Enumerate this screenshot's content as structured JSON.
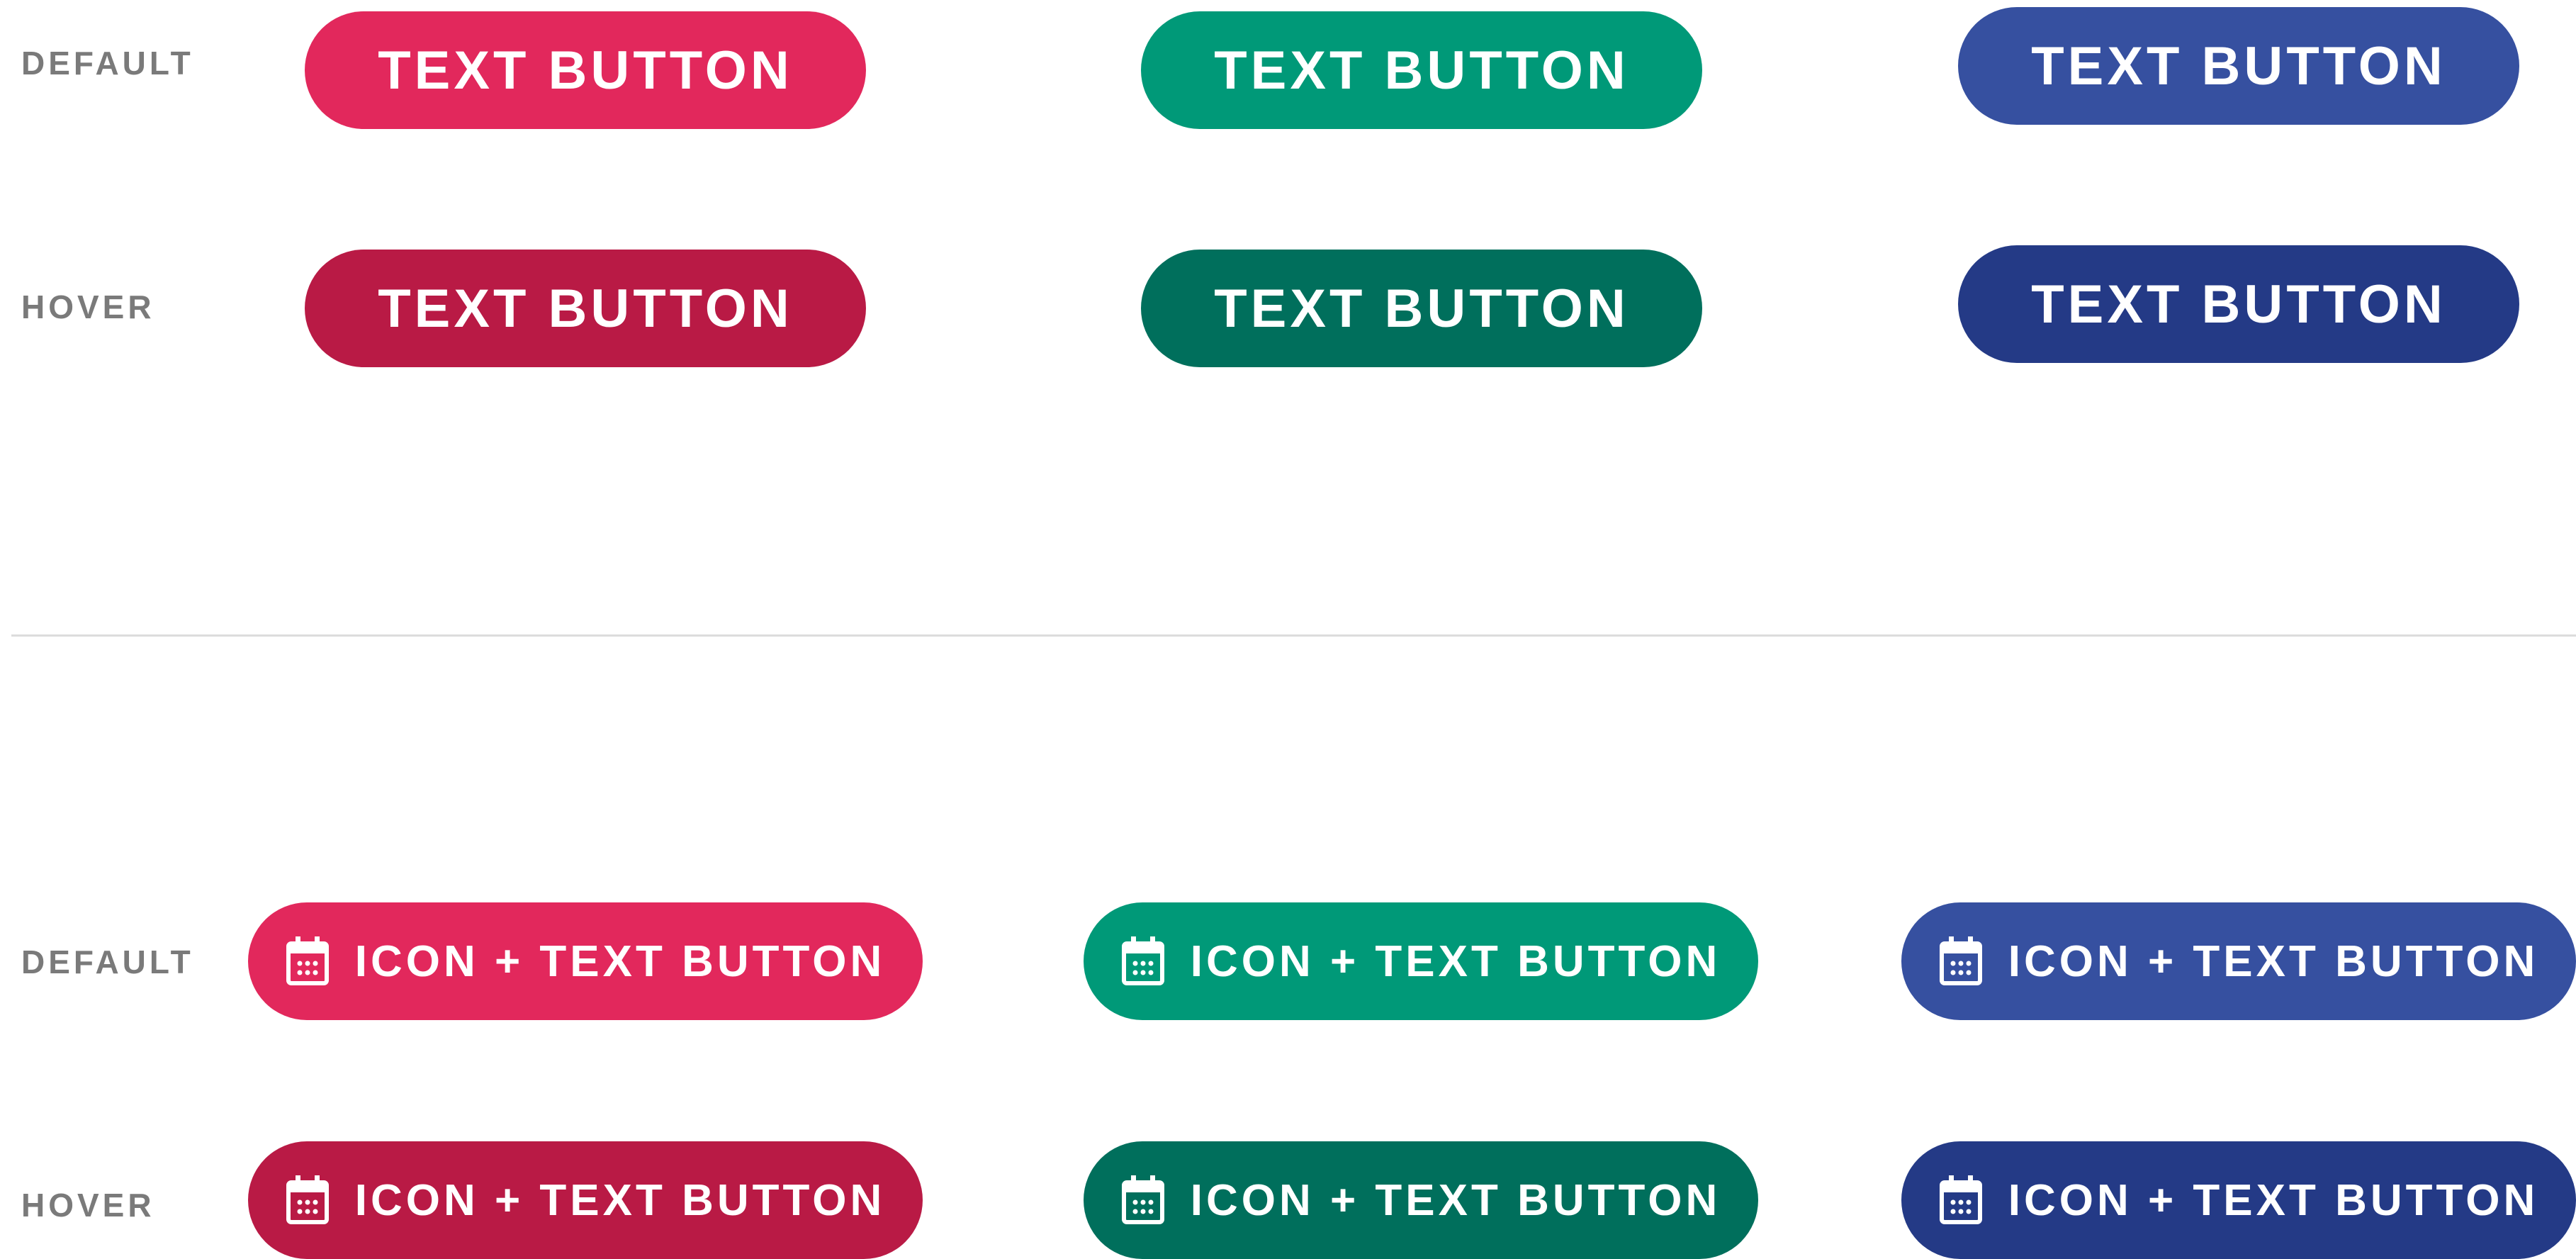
{
  "colors": {
    "red_default": "#E2285C",
    "red_hover": "#B91A45",
    "green_default": "#009978",
    "green_hover": "#006F5C",
    "blue_default": "#3650A0",
    "blue_hover": "#243A86",
    "label_gray": "#7A7A7A",
    "divider": "#DCDCDC"
  },
  "text_section": {
    "default_label": "DEFAULT",
    "hover_label": "HOVER",
    "button_label": "TEXT BUTTON"
  },
  "icon_section": {
    "default_label": "DEFAULT",
    "hover_label": "HOVER",
    "button_label": "ICON + TEXT BUTTON",
    "icon": "calendar-icon"
  }
}
